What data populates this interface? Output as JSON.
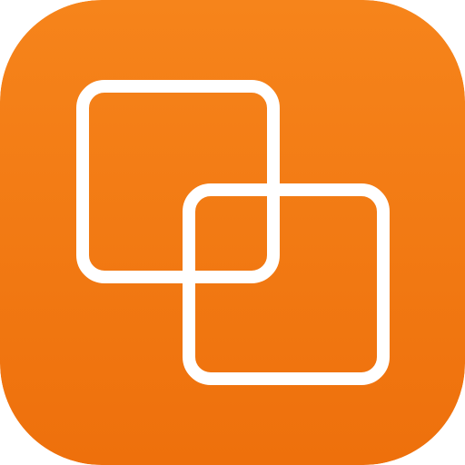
{
  "app_icon": {
    "icon_name": "overlapping-squares-icon",
    "colors": {
      "background_top": "#F6841B",
      "background_bottom": "#EE700C",
      "stroke": "#FFFFFF"
    }
  }
}
